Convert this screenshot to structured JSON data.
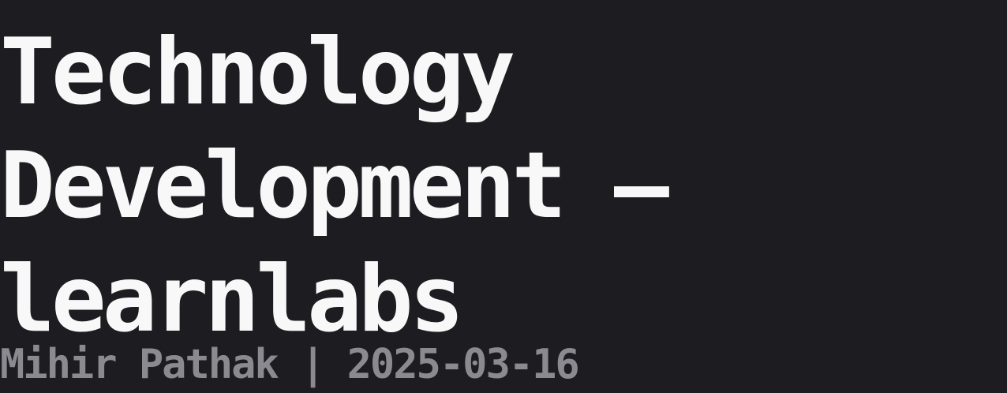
{
  "post": {
    "title_lines": [
      "Technology",
      "Development –",
      "learnlabs"
    ],
    "author": "Mihir Pathak",
    "separator": "|",
    "date": "2025-03-16"
  },
  "colors": {
    "background": "#1c1c21",
    "title": "#f8f8f8",
    "meta": "#8a8a90"
  }
}
